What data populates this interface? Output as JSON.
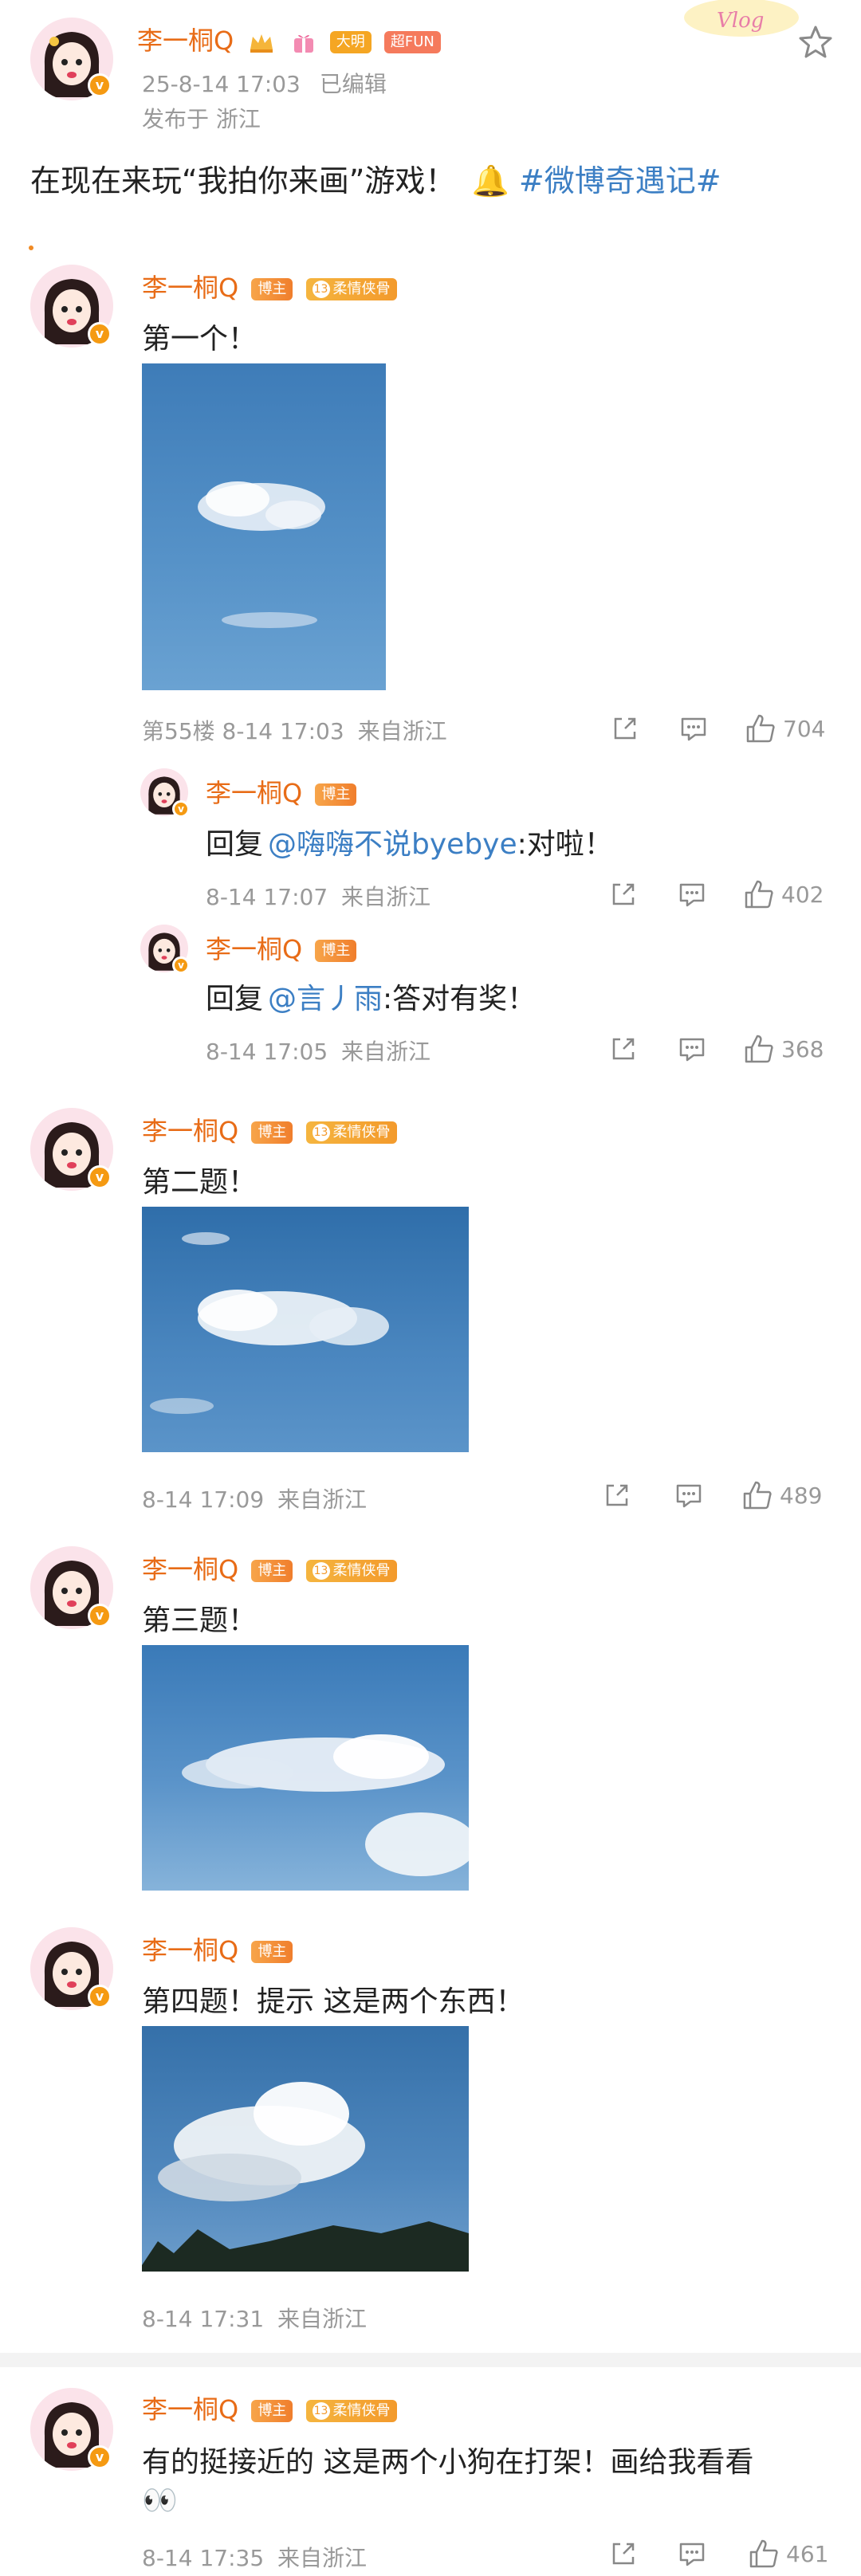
{
  "post": {
    "author": "李一桐Q",
    "badge_1": "大明",
    "badge_2": "超FUN",
    "time": "25-8-14 17:03",
    "edited": "已编辑",
    "location": "发布于 浙江",
    "content": "在现在来玩“我拍你来画”游戏！",
    "topic": "#微博奇遇记#",
    "corner_sticker": "Vlog"
  },
  "badges": {
    "blogger": "博主",
    "level": "13",
    "fan": "柔情侠骨"
  },
  "comments": [
    {
      "author": "李一桐Q",
      "text": "第一个！",
      "floor": "第55楼",
      "time": "8-14 17:03",
      "from": "来自浙江",
      "likes": "704"
    },
    {
      "author": "李一桐Q",
      "reply_prefix": "回复",
      "mention": "@嗨嗨不说byebye",
      "text": ":对啦！",
      "time": "8-14 17:07",
      "from": "来自浙江",
      "likes": "402"
    },
    {
      "author": "李一桐Q",
      "reply_prefix": "回复",
      "mention": "@言丿雨",
      "text": ":答对有奖！",
      "time": "8-14 17:05",
      "from": "来自浙江",
      "likes": "368"
    },
    {
      "author": "李一桐Q",
      "text": "第二题！",
      "time": "8-14 17:09",
      "from": "来自浙江",
      "likes": "489"
    },
    {
      "author": "李一桐Q",
      "text": "第三题！",
      "time": "",
      "from": "",
      "likes": ""
    },
    {
      "author": "李一桐Q",
      "text": "第四题！提示 这是两个东西！",
      "time": "8-14 17:31",
      "from": "来自浙江",
      "likes": ""
    },
    {
      "author": "李一桐Q",
      "text": "有的挺接近的 这是两个小狗在打架！画给我看看",
      "emoji": "👀",
      "time": "8-14 17:35",
      "from": "来自浙江",
      "likes": "461"
    }
  ]
}
